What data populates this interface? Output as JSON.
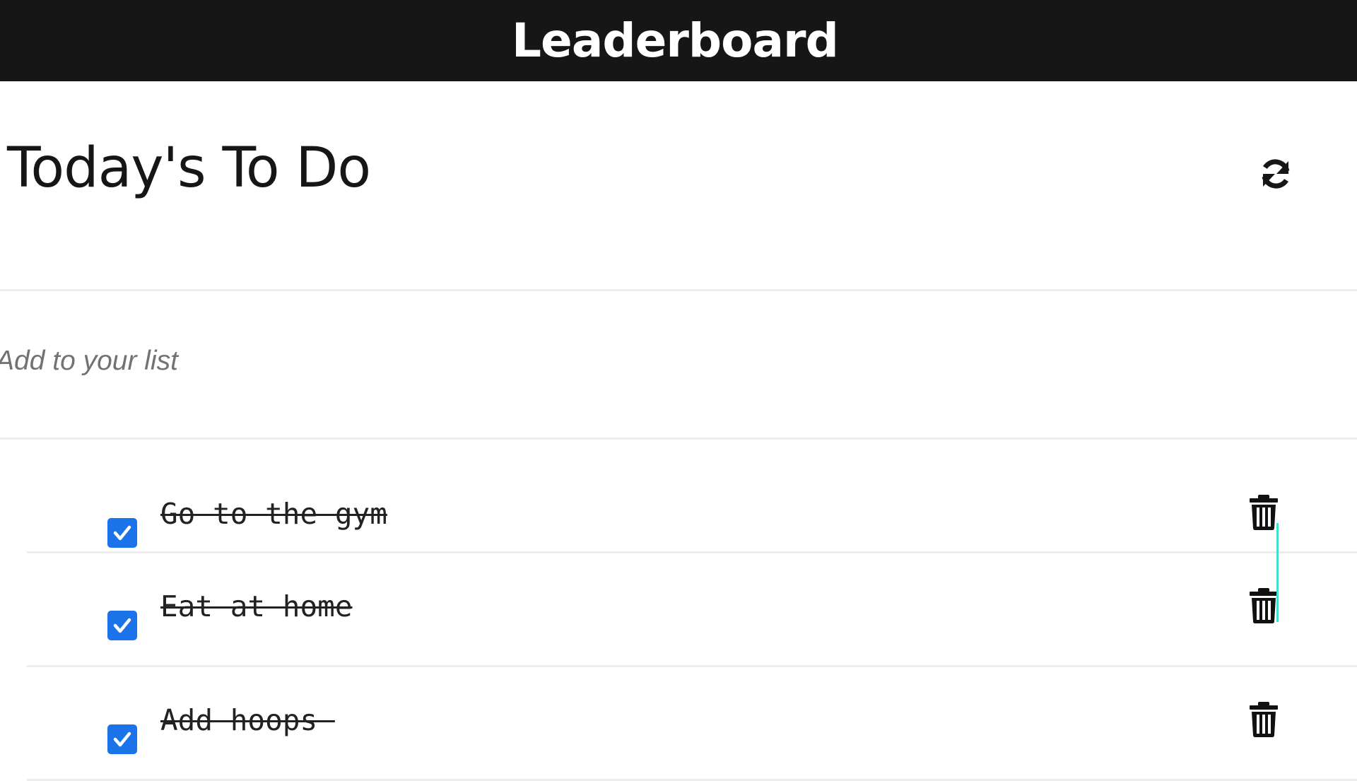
{
  "topbar": {
    "title": "Leaderboard"
  },
  "header": {
    "title": "Today's To Do",
    "refresh_icon": "refresh-icon"
  },
  "add_input": {
    "placeholder": "Add to your list",
    "value": ""
  },
  "tasks": [
    {
      "label": "Go to the gym",
      "completed": true
    },
    {
      "label": "Eat at home",
      "completed": true
    },
    {
      "label": "Add hoops ",
      "completed": true
    }
  ],
  "colors": {
    "topbar_bg": "#161616",
    "checkbox": "#1a73e8",
    "divider": "#ececec",
    "drag_indicator": "#40e0d0"
  }
}
